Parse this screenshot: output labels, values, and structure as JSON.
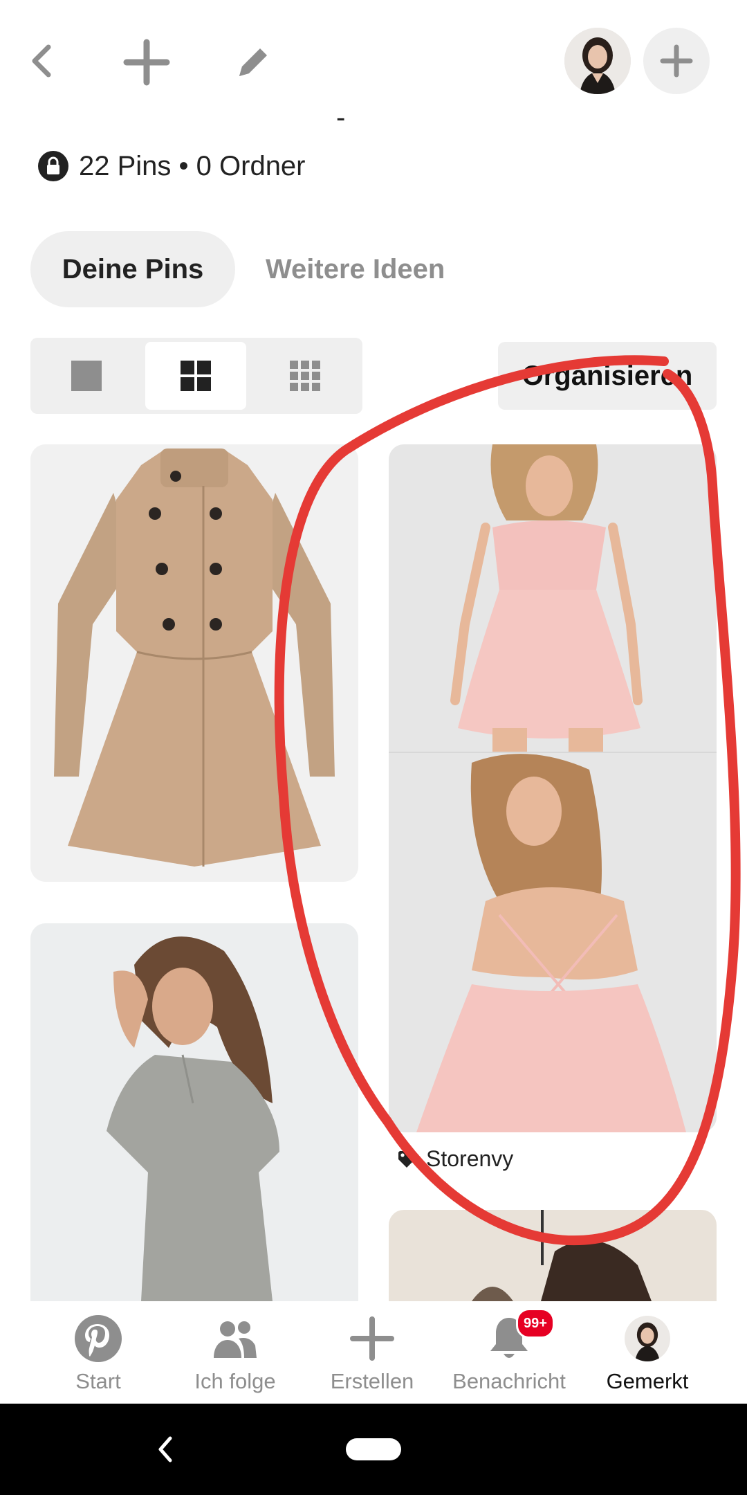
{
  "top_bar": {
    "back_icon": "chevron-left-icon",
    "add_icon": "plus-icon",
    "edit_icon": "pencil-icon",
    "profile_avatar": "avatar",
    "follow_icon": "plus-icon"
  },
  "board": {
    "title_fragment": "-",
    "stats": "22 Pins • 0 Ordner",
    "secret_icon": "lock-icon"
  },
  "tabs": [
    {
      "label": "Deine Pins",
      "active": true
    },
    {
      "label": "Weitere Ideen",
      "active": false
    }
  ],
  "view_options": [
    "single-view-icon",
    "grid-view-icon",
    "compact-grid-view-icon"
  ],
  "organize_label": "Organisieren",
  "pins": [
    {
      "image": "beige-coat-photo"
    },
    {
      "image": "grey-dress-photo"
    },
    {
      "image": "pink-dress-photo",
      "source": "Storenvy",
      "source_icon": "tag-icon"
    },
    {
      "image": "next-pin-photo"
    }
  ],
  "annotation": {
    "color": "#e53a35"
  },
  "bottom_nav": [
    {
      "label": "Start",
      "icon": "pinterest-logo-icon",
      "active": false
    },
    {
      "label": "Ich folge",
      "icon": "people-icon",
      "active": false
    },
    {
      "label": "Erstellen",
      "icon": "plus-icon",
      "active": false
    },
    {
      "label": "Benachricht",
      "icon": "bell-icon",
      "active": false,
      "badge": "99+"
    },
    {
      "label": "Gemerkt",
      "icon": "avatar",
      "active": true
    }
  ],
  "colors": {
    "brand_red": "#e60023",
    "icon_grey": "#8e8e8e"
  }
}
